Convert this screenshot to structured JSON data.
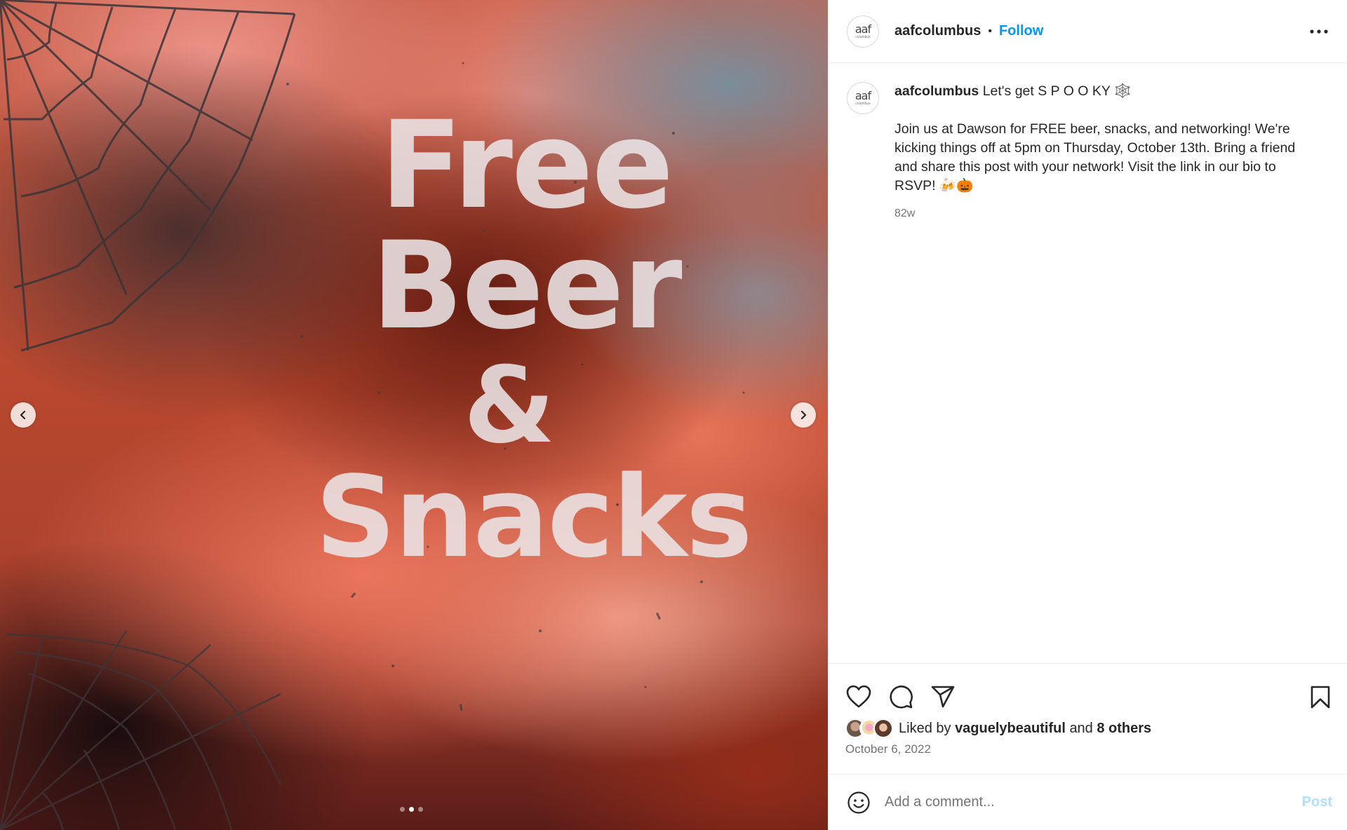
{
  "media": {
    "headline_line1": "Free Beer",
    "headline_line2": "&",
    "headline_line3": "Snacks",
    "slide_count": 3,
    "active_slide": 2
  },
  "header": {
    "username": "aafcolumbus",
    "separator": "•",
    "follow_label": "Follow",
    "avatar_logo": "aaf",
    "avatar_sub": "columbus"
  },
  "caption": {
    "username": "aafcolumbus",
    "headline": "Let's get S P O O KY",
    "spider_web": "🕸️",
    "body": "Join us at Dawson for FREE beer, snacks, and networking! We're kicking things off at 5pm on Thursday, October 13th. Bring a friend and share this post with your network! Visit the link in our bio to RSVP! 🍻🎃",
    "age": "82w"
  },
  "actions": {
    "icons": [
      "heart-icon",
      "comment-icon",
      "share-icon",
      "bookmark-icon"
    ]
  },
  "likes": {
    "prefix": "Liked by",
    "user": "vaguelybeautiful",
    "conjunction": "and",
    "others": "8 others"
  },
  "date": "October 6, 2022",
  "comment": {
    "placeholder": "Add a comment...",
    "post_label": "Post"
  },
  "colors": {
    "follow": "#0095f6",
    "post_disabled": "#b2dffc",
    "secondary_text": "#737373"
  }
}
